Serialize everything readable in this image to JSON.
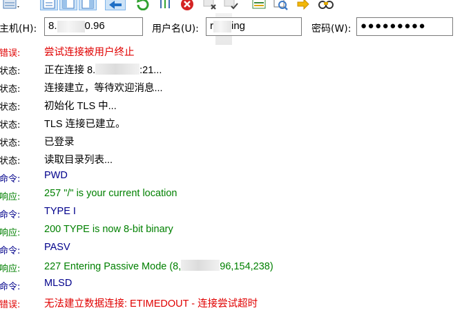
{
  "toolbar": {
    "buttons": [
      {
        "icon": "site-manager-icon",
        "color": "#4a7bb7"
      },
      {
        "icon": "message-log-toggle-icon",
        "color": "#3b78c6"
      },
      {
        "icon": "local-tree-toggle-icon",
        "color": "#3b78c6"
      },
      {
        "icon": "remote-tree-toggle-icon",
        "color": "#3b78c6"
      },
      {
        "icon": "transfer-queue-toggle-icon",
        "color": "#3b78c6"
      },
      {
        "icon": "refresh-icon",
        "color": "#2fa12f"
      },
      {
        "icon": "process-queue-icon",
        "color": "#3c6fb0"
      },
      {
        "icon": "cancel-icon",
        "color": "#d42323"
      },
      {
        "icon": "disconnect-icon",
        "color": "#555555"
      },
      {
        "icon": "reconnect-icon",
        "color": "#555555"
      },
      {
        "icon": "directory-compare-icon",
        "color": "#3a8a3a"
      },
      {
        "icon": "filter-icon",
        "color": "#3b78c6"
      },
      {
        "icon": "sync-browse-icon",
        "color": "#e0a800"
      },
      {
        "icon": "search-icon",
        "color": "#555555"
      }
    ]
  },
  "quickconnect": {
    "host_label": "主机(H):",
    "host_value_prefix": "8.",
    "host_value_suffix": "0.96",
    "user_label": "用户名(U):",
    "user_value_prefix": "r",
    "user_value_suffix": "ing",
    "password_label": "密码(W):",
    "password_value": "●●●●●●●●●"
  },
  "log": [
    {
      "type": "错误:",
      "kind": "error",
      "message": "尝试连接被用户终止"
    },
    {
      "type": "状态:",
      "kind": "status",
      "message_prefix": "正在连接 8.",
      "message_suffix": ":21..."
    },
    {
      "type": "状态:",
      "kind": "status",
      "message": "连接建立，等待欢迎消息..."
    },
    {
      "type": "状态:",
      "kind": "status",
      "message": "初始化 TLS 中..."
    },
    {
      "type": "状态:",
      "kind": "status",
      "message": "TLS 连接已建立。"
    },
    {
      "type": "状态:",
      "kind": "status",
      "message": "已登录"
    },
    {
      "type": "状态:",
      "kind": "status",
      "message": "读取目录列表..."
    },
    {
      "type": "命令:",
      "kind": "command",
      "message": "PWD"
    },
    {
      "type": "响应:",
      "kind": "response",
      "message": "257 \"/\" is your current location"
    },
    {
      "type": "命令:",
      "kind": "command",
      "message": "TYPE I"
    },
    {
      "type": "响应:",
      "kind": "response",
      "message": "200 TYPE is now 8-bit binary"
    },
    {
      "type": "命令:",
      "kind": "command",
      "message": "PASV"
    },
    {
      "type": "响应:",
      "kind": "response",
      "message_prefix": "227 Entering Passive Mode (8,",
      "message_suffix": "96,154,238)"
    },
    {
      "type": "命令:",
      "kind": "command",
      "message": "MLSD"
    },
    {
      "type": "错误:",
      "kind": "error",
      "message": "无法建立数据连接: ETIMEDOUT - 连接尝试超时"
    }
  ],
  "colors": {
    "error": "#e00000",
    "status": "#000000",
    "command": "#00008b",
    "response": "#008000"
  }
}
